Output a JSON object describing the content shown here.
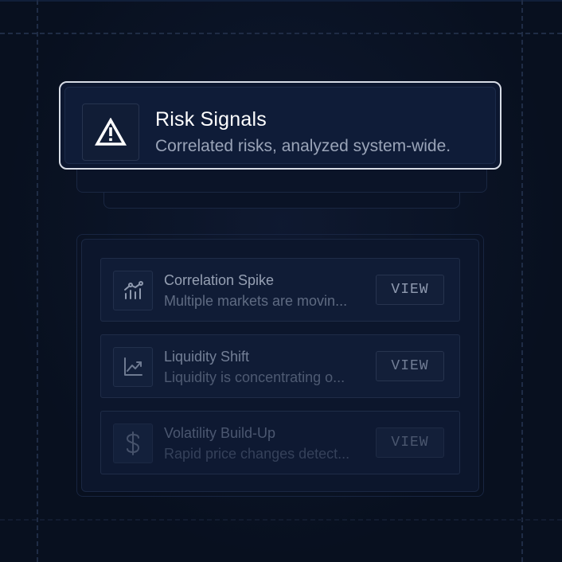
{
  "header": {
    "title": "Risk Signals",
    "subtitle": "Correlated risks, analyzed system-wide.",
    "icon": "warning-triangle-icon"
  },
  "signals": [
    {
      "title": "Correlation Spike",
      "description": "Multiple markets are movin...",
      "icon": "correlation-chart-icon",
      "action_label": "VIEW"
    },
    {
      "title": "Liquidity Shift",
      "description": "Liquidity is concentrating o...",
      "icon": "trend-up-chart-icon",
      "action_label": "VIEW"
    },
    {
      "title": "Volatility Build-Up",
      "description": "Rapid price changes detect...",
      "icon": "dollar-sign-icon",
      "action_label": "VIEW"
    }
  ],
  "colors": {
    "background": "#08101f",
    "card": "#0f1c38",
    "header_border": "#d7dce6",
    "title_text": "#ffffff",
    "muted_text": "#9aa4b8"
  }
}
